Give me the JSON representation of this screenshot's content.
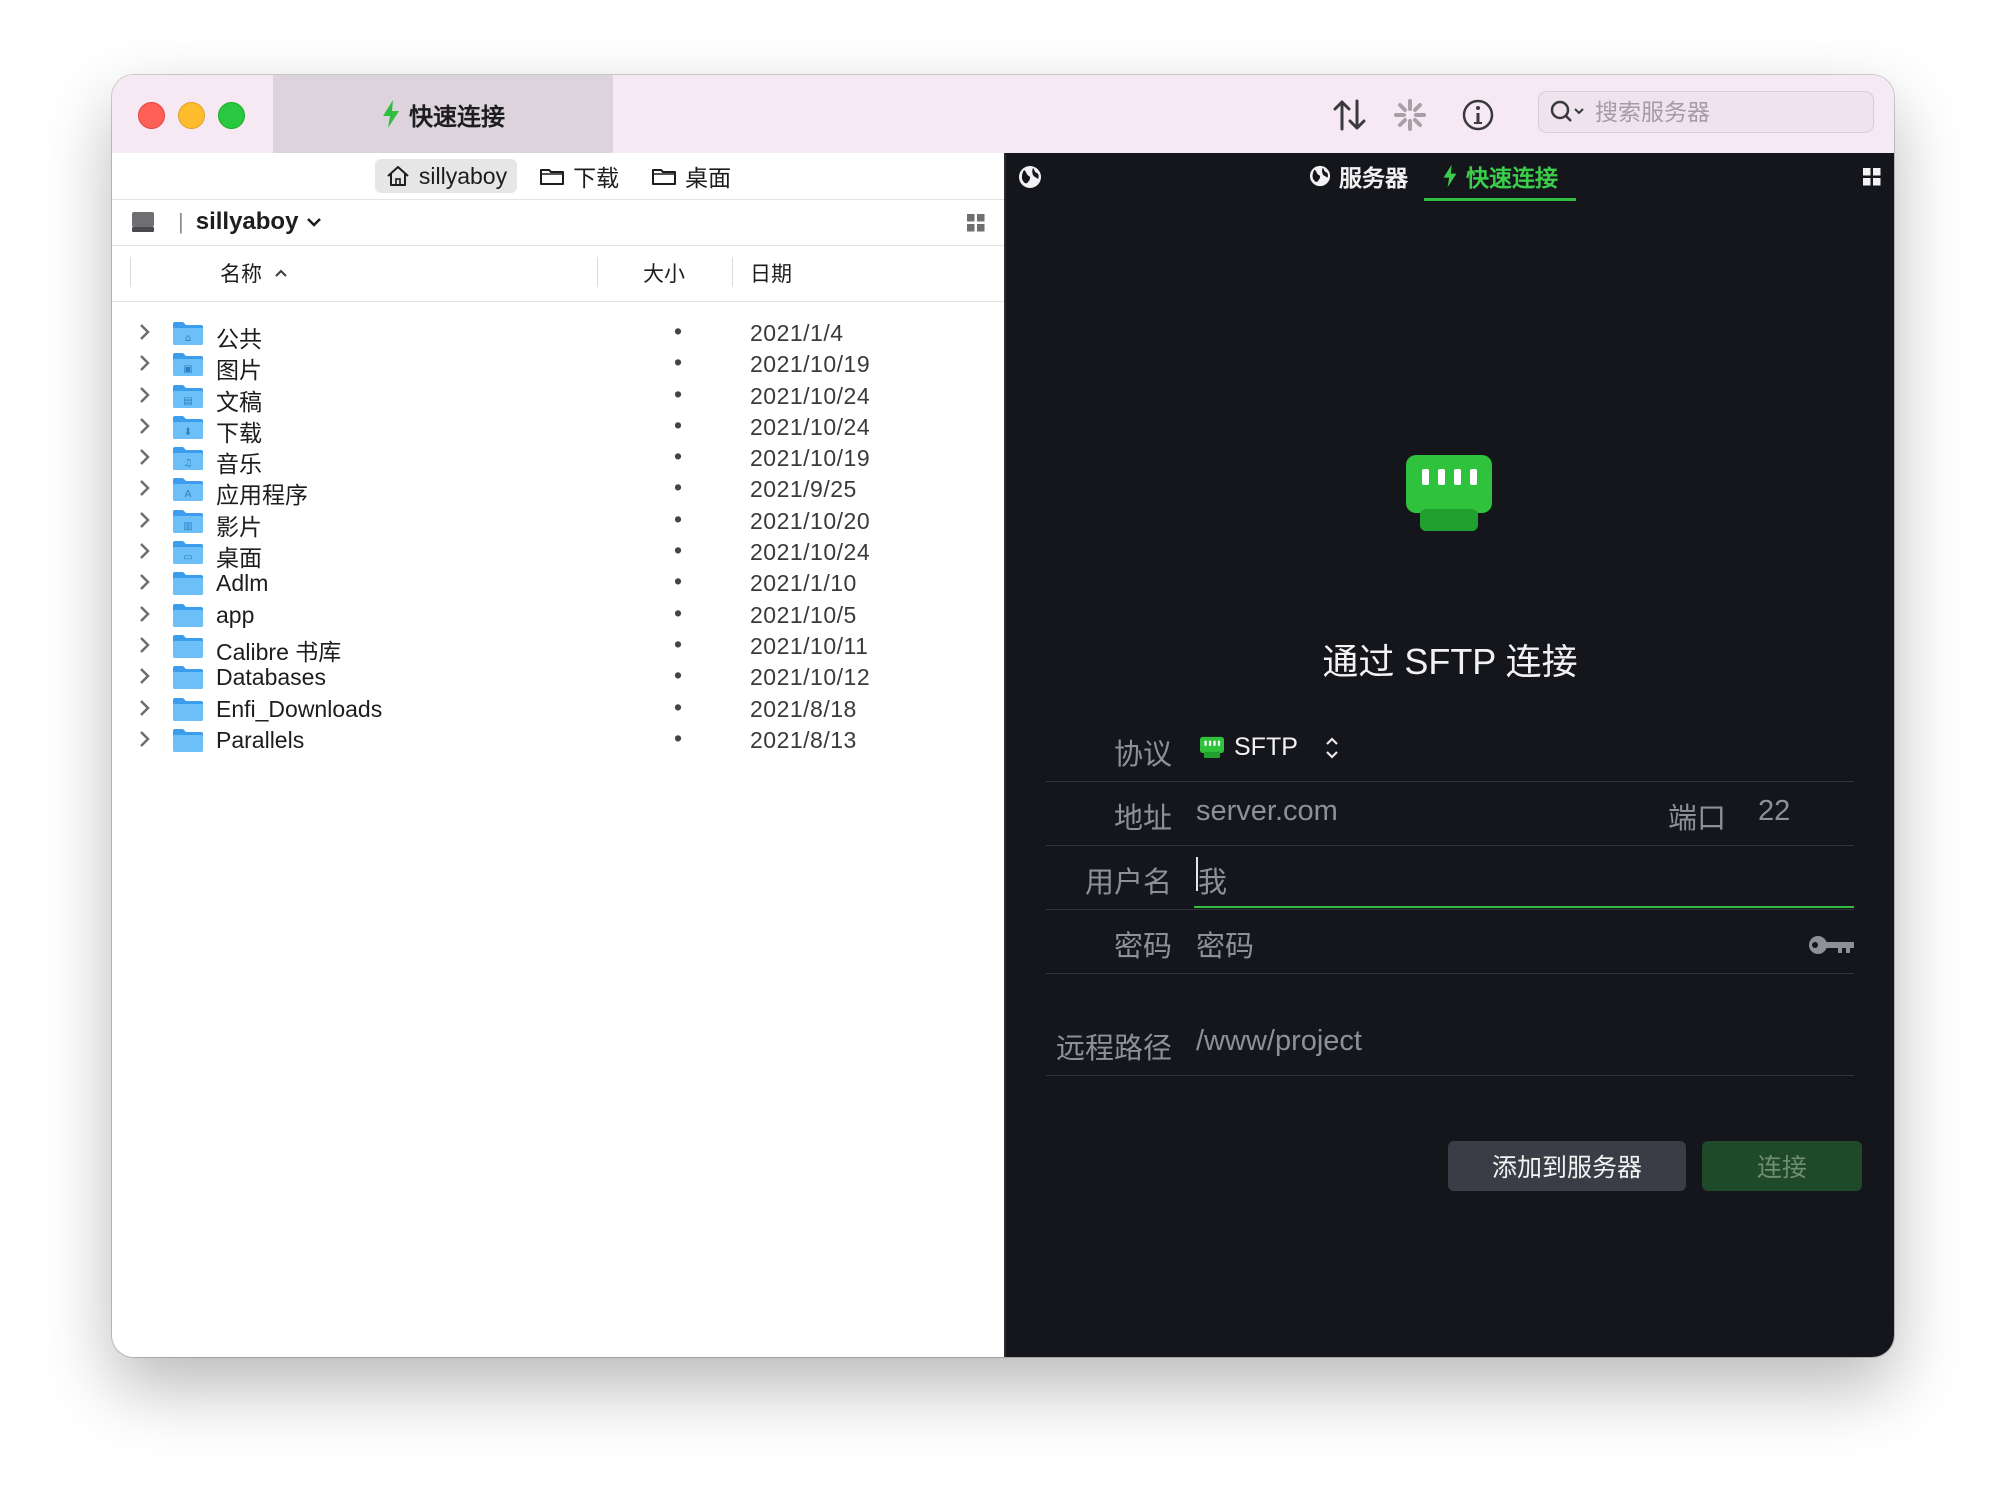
{
  "titlebar": {
    "tab_label": "快速连接",
    "search_placeholder": "搜索服务器"
  },
  "left": {
    "breadcrumbs": [
      {
        "label": "sillyaboy",
        "icon": "home-icon"
      },
      {
        "label": "下载",
        "icon": "folder-icon"
      },
      {
        "label": "桌面",
        "icon": "folder-icon"
      }
    ],
    "location": "sillyaboy",
    "columns": {
      "name": "名称",
      "size": "大小",
      "date": "日期"
    },
    "files": [
      {
        "name": "公共",
        "size": "•",
        "date": "2021/1/4"
      },
      {
        "name": "图片",
        "size": "•",
        "date": "2021/10/19"
      },
      {
        "name": "文稿",
        "size": "•",
        "date": "2021/10/24"
      },
      {
        "name": "下载",
        "size": "•",
        "date": "2021/10/24"
      },
      {
        "name": "音乐",
        "size": "•",
        "date": "2021/10/19"
      },
      {
        "name": "应用程序",
        "size": "•",
        "date": "2021/9/25"
      },
      {
        "name": "影片",
        "size": "•",
        "date": "2021/10/20"
      },
      {
        "name": "桌面",
        "size": "•",
        "date": "2021/10/24"
      },
      {
        "name": "Adlm",
        "size": "•",
        "date": "2021/1/10"
      },
      {
        "name": "app",
        "size": "•",
        "date": "2021/10/5"
      },
      {
        "name": "Calibre 书库",
        "size": "•",
        "date": "2021/10/11"
      },
      {
        "name": "Databases",
        "size": "•",
        "date": "2021/10/12"
      },
      {
        "name": "Enfi_Downloads",
        "size": "•",
        "date": "2021/8/18"
      },
      {
        "name": "Parallels",
        "size": "•",
        "date": "2021/8/13"
      }
    ]
  },
  "right": {
    "tabs": {
      "servers": "服务器",
      "quick_connect": "快速连接"
    },
    "title": "通过 SFTP 连接",
    "form": {
      "protocol_label": "协议",
      "protocol_value": "SFTP",
      "address_label": "地址",
      "address_placeholder": "server.com",
      "port_label": "端口",
      "port_placeholder": "22",
      "username_label": "用户名",
      "username_placeholder": "我",
      "password_label": "密码",
      "password_placeholder": "密码",
      "remote_path_label": "远程路径",
      "remote_path_placeholder": "/www/project"
    },
    "buttons": {
      "add": "添加到服务器",
      "connect": "连接"
    }
  },
  "colors": {
    "accent": "#2fbe3f",
    "dark_bg": "#14161c",
    "titlebar": "#f6e9f4"
  }
}
